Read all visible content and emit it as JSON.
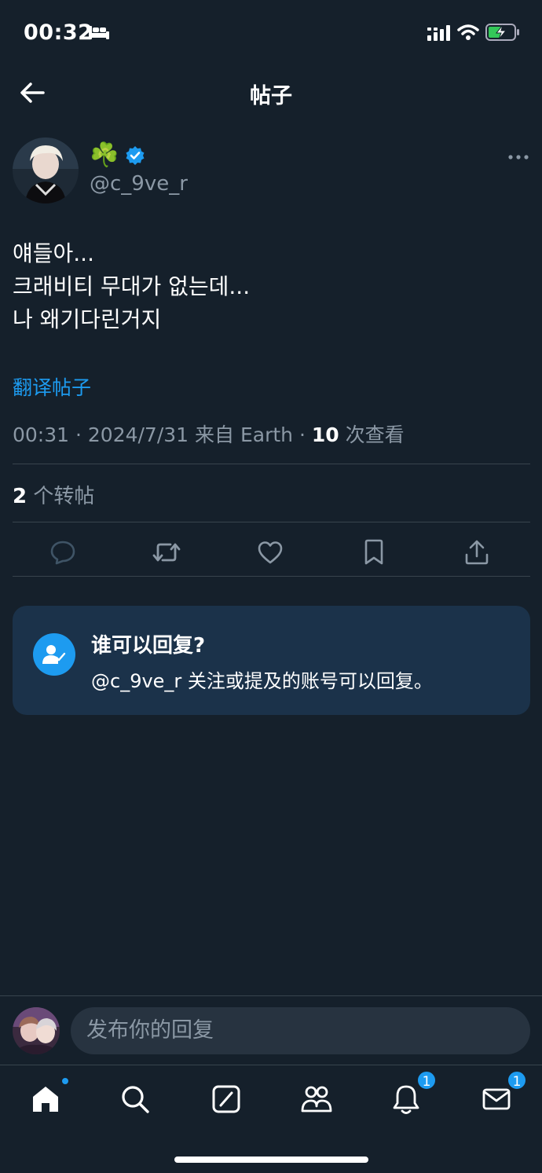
{
  "status_bar": {
    "time": "00:32"
  },
  "header": {
    "title": "帖子"
  },
  "author": {
    "name_emoji": "☘️",
    "handle": "@c_9ve_r"
  },
  "post": {
    "lines": [
      "얘들아...",
      "크래비티 무대가 없는데...",
      "나 왜기다린거지"
    ],
    "translate_label": "翻译帖子",
    "meta_prefix": "00:31 · 2024/7/31 来自 Earth · ",
    "views_count": "10",
    "views_label": " 次查看"
  },
  "stats": {
    "reposts_count": "2",
    "reposts_label": " 个转帖"
  },
  "reply_restriction": {
    "title": "谁可以回复?",
    "text": "@c_9ve_r 关注或提及的账号可以回复。"
  },
  "compose": {
    "placeholder": "发布你的回复"
  },
  "tabs": {
    "notifications_badge": "1",
    "messages_badge": "1"
  },
  "colors": {
    "background": "#15202b",
    "accent": "#1d9bf0",
    "muted": "#8b98a5",
    "card": "#1b324a"
  },
  "icons": [
    "back-arrow-icon",
    "verified-icon",
    "more-icon",
    "reply-icon",
    "repost-icon",
    "like-icon",
    "bookmark-icon",
    "share-icon",
    "person-check-icon",
    "home-icon",
    "search-icon",
    "grok-icon",
    "communities-icon",
    "bell-icon",
    "mail-icon"
  ]
}
